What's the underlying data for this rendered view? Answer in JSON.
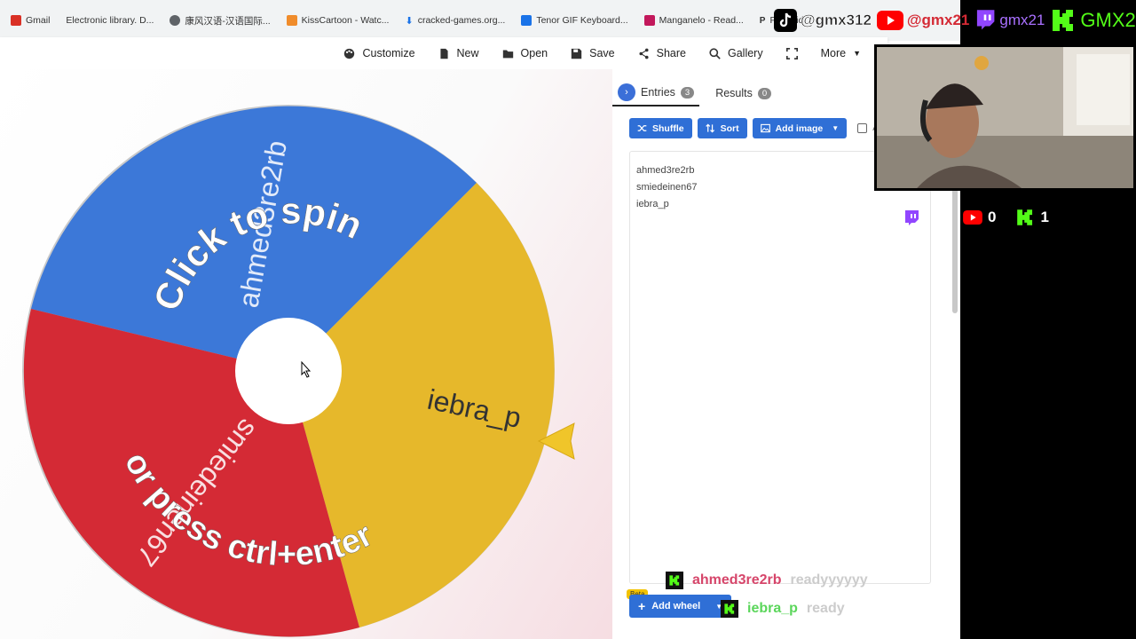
{
  "bookmarks": [
    {
      "label": "Gmail",
      "color": "#d93025"
    },
    {
      "label": "Electronic library. D...",
      "color": "#888888"
    },
    {
      "label": "康风汉语-汉语国际...",
      "color": "#5f6368"
    },
    {
      "label": "KissCartoon - Watc...",
      "color": "#f08c2b"
    },
    {
      "label": "cracked-games.org...",
      "color": "#1a73e8"
    },
    {
      "label": "Tenor GIF Keyboard...",
      "color": "#1a73e8"
    },
    {
      "label": "Manganelo - Read...",
      "color": "#c2185b"
    },
    {
      "label": "Panzoid",
      "color": "#333333"
    }
  ],
  "toolbar": {
    "customize": "Customize",
    "new": "New",
    "open": "Open",
    "save": "Save",
    "share": "Share",
    "gallery": "Gallery",
    "more": "More"
  },
  "wheel": {
    "segments": [
      {
        "label": "ahmed3re2rb",
        "color": "#3c78d8"
      },
      {
        "label": "iebra_p",
        "color": "#e6b82b"
      },
      {
        "label": "smiedeinen67",
        "color": "#d42a35"
      }
    ],
    "prompt_top": "Click to spin",
    "prompt_bottom": "or press ctrl+enter"
  },
  "panel": {
    "tabs": [
      {
        "label": "Entries",
        "count": "3"
      },
      {
        "label": "Results",
        "count": "0"
      }
    ],
    "buttons": {
      "shuffle": "Shuffle",
      "sort": "Sort",
      "add_image": "Add image",
      "advanced": "Adva"
    },
    "entries": [
      "ahmed3re2rb",
      "smiedeinen67",
      "iebra_p"
    ],
    "add_wheel": "Add wheel",
    "beta": "Beta"
  },
  "overlay": {
    "tiktok": "@gmx312",
    "youtube": "@gmx21",
    "twitch": "gmx21",
    "kick": "GMX2",
    "youtube_count": "0",
    "kick_count": "1",
    "chat": [
      {
        "user": "ahmed3re2rb",
        "message": "readyyyyyy",
        "user_color": "#d6456a"
      },
      {
        "user": "iebra_p",
        "message": "ready",
        "user_color": "#5bd65b"
      }
    ]
  }
}
